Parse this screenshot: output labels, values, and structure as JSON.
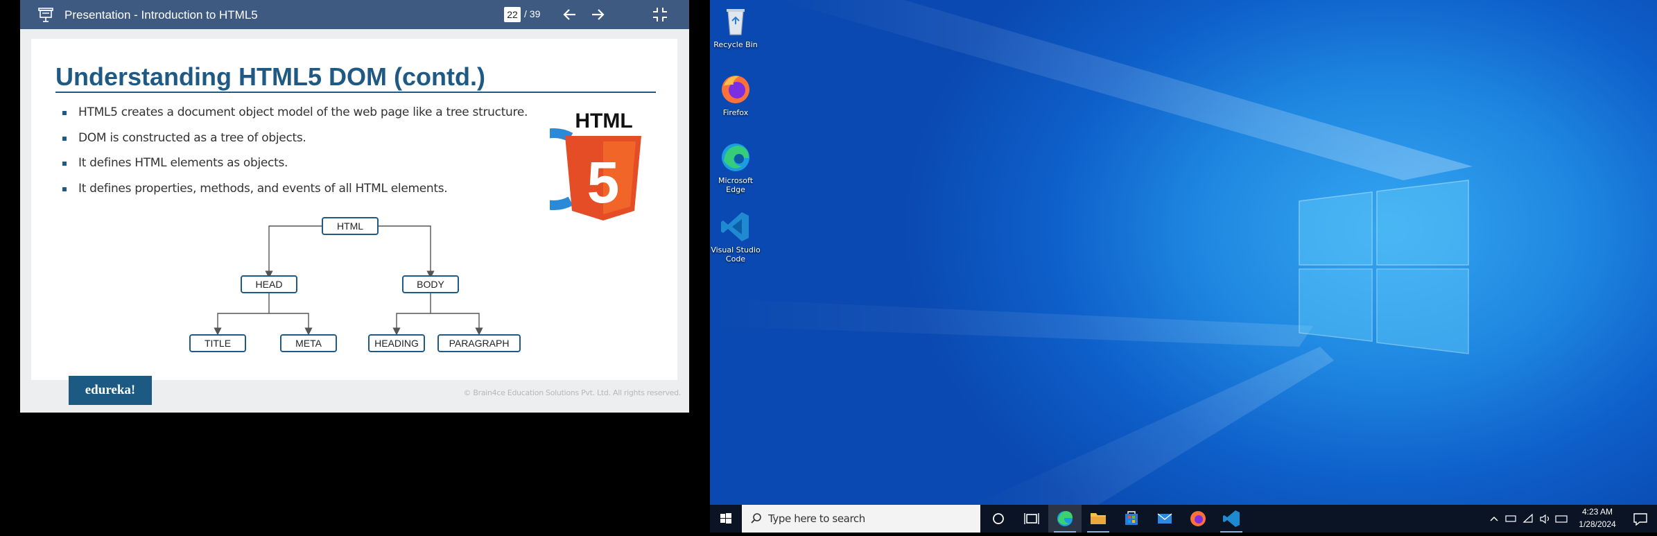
{
  "viewer": {
    "title": "Presentation - Introduction to HTML5",
    "current_page": "22",
    "total_pages": "/ 39"
  },
  "slide": {
    "title": "Understanding HTML5 DOM (contd.)",
    "bullets": [
      "HTML5 creates a document object model of the web page like a tree structure.",
      "DOM is constructed as a tree of objects.",
      "It defines HTML elements as objects.",
      "It defines properties, methods, and events of all HTML elements."
    ],
    "tree": {
      "root": "HTML",
      "left": "HEAD",
      "right": "BODY",
      "left_children": [
        "TITLE",
        "META"
      ],
      "right_children": [
        "HEADING",
        "PARAGRAPH"
      ]
    },
    "logo_text": "HTML",
    "logo_digit": "5",
    "brand": "edureka!",
    "copyright": "© Brain4ce Education Solutions Pvt. Ltd. All rights reserved."
  },
  "desktop": {
    "icons": [
      "Recycle Bin",
      "Firefox",
      "Microsoft Edge",
      "Visual Studio Code"
    ]
  },
  "taskbar": {
    "search_placeholder": "Type here to search",
    "time": "4:23 AM",
    "date": "1/28/2024"
  },
  "colors": {
    "viewer_bar": "#3f5a80",
    "slide_title": "#1f5a85",
    "taskbar": "#0b1424",
    "desktop": "#0e5fc9"
  }
}
